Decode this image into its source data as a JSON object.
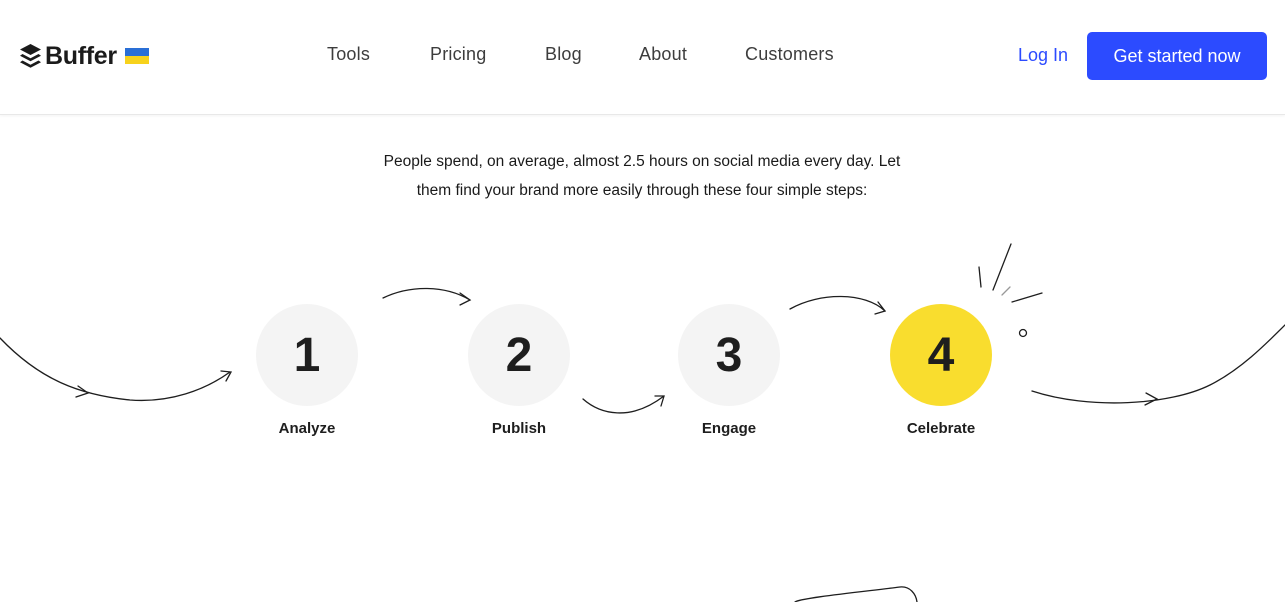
{
  "header": {
    "brand": "Buffer",
    "nav": [
      {
        "label": "Tools"
      },
      {
        "label": "Pricing"
      },
      {
        "label": "Blog"
      },
      {
        "label": "About"
      },
      {
        "label": "Customers"
      }
    ],
    "login_label": "Log In",
    "cta_label": "Get started now"
  },
  "intro": {
    "line1": "People spend, on average, almost 2.5 hours on social media every day. Let",
    "line2": "them find your brand more easily through these four simple steps:"
  },
  "steps": [
    {
      "number": "1",
      "label": "Analyze"
    },
    {
      "number": "2",
      "label": "Publish"
    },
    {
      "number": "3",
      "label": "Engage"
    },
    {
      "number": "4",
      "label": "Celebrate"
    }
  ],
  "colors": {
    "accent": "#2c4bff",
    "highlight": "#f9dd2e",
    "flag_blue": "#2a6fd6",
    "flag_yellow": "#f7d21c"
  }
}
